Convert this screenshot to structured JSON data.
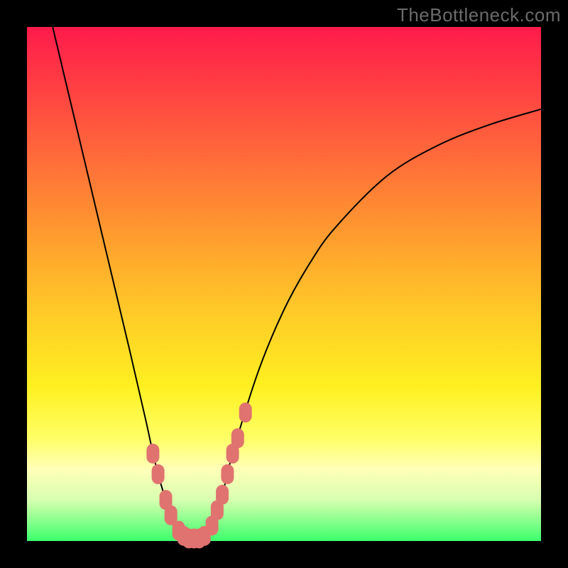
{
  "watermark": "TheBottleneck.com",
  "colors": {
    "frame": "#000000",
    "curve": "#000000",
    "marker": "#e0736f",
    "gradient_top": "#ff1a4b",
    "gradient_mid": "#fff020",
    "gradient_bottom": "#3bff6a"
  },
  "chart_data": {
    "type": "line",
    "title": "",
    "xlabel": "",
    "ylabel": "",
    "xlim": [
      0,
      100
    ],
    "ylim": [
      0,
      100
    ],
    "grid": false,
    "series": [
      {
        "name": "bottleneck-curve",
        "x": [
          5,
          10,
          15,
          20,
          23,
          25,
          27,
          29,
          30,
          31,
          32,
          33,
          34,
          35,
          36,
          38,
          40,
          45,
          50,
          55,
          60,
          70,
          80,
          90,
          100
        ],
        "y": [
          100,
          79,
          58,
          37,
          24,
          15,
          8,
          3,
          1,
          0,
          0,
          0,
          0,
          1,
          3,
          9,
          17,
          33,
          45,
          54,
          61,
          71,
          77,
          81,
          84
        ]
      }
    ],
    "markers": {
      "name": "highlighted-points",
      "x": [
        24.5,
        25.5,
        27,
        28,
        29.5,
        30.5,
        31.5,
        32.5,
        33.5,
        34.5,
        36,
        37,
        38,
        39,
        40,
        41,
        42.5
      ],
      "y": [
        17,
        13,
        8,
        5,
        2,
        1,
        0.5,
        0.5,
        0.5,
        1,
        3,
        6,
        9,
        13,
        17,
        20,
        25
      ]
    },
    "minimum_at_x": 32
  }
}
